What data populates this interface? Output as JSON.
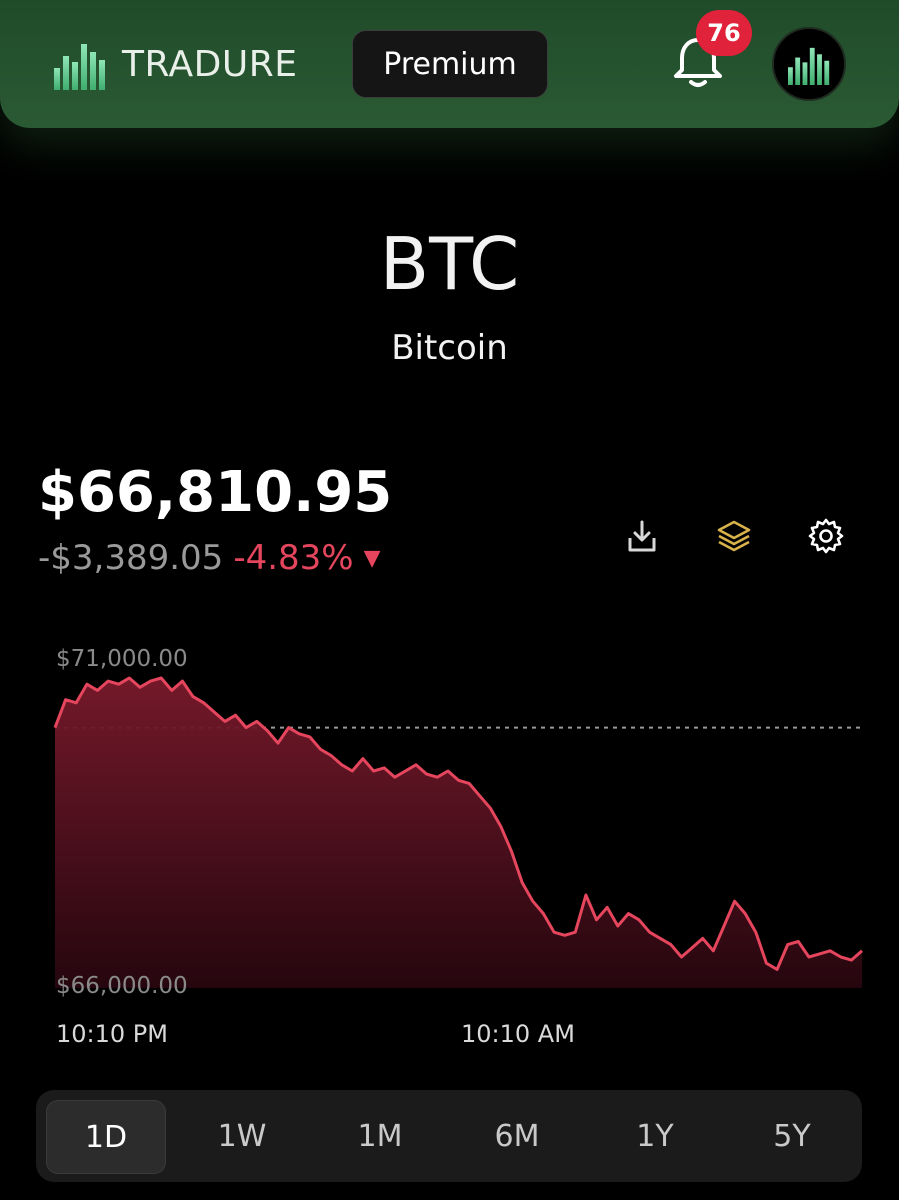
{
  "header": {
    "brand_name": "TRADURE",
    "premium_label": "Premium",
    "notification_count": "76",
    "accent": "#2a5a33"
  },
  "asset": {
    "ticker": "BTC",
    "name": "Bitcoin"
  },
  "price": {
    "current": "$66,810.95",
    "change_abs": "-$3,389.05",
    "change_pct": "-4.83%",
    "direction_icon": "caret-down-icon",
    "negative_color": "#e5465d"
  },
  "tools": [
    {
      "icon": "download-icon"
    },
    {
      "icon": "layers-icon"
    },
    {
      "icon": "gear-icon"
    }
  ],
  "chart_data": {
    "type": "area",
    "y_max_label": "$71,000.00",
    "y_min_label": "$66,000.00",
    "ylim": [
      66000,
      71000
    ],
    "reference_line": 70200,
    "x_labels": [
      "10:10 PM",
      "10:10 AM"
    ],
    "color": "#e5465d",
    "values": [
      70200,
      70650,
      70600,
      70900,
      70800,
      70950,
      70900,
      71000,
      70850,
      70950,
      71000,
      70800,
      70950,
      70700,
      70600,
      70450,
      70300,
      70400,
      70200,
      70300,
      70150,
      69950,
      70200,
      70100,
      70050,
      69850,
      69750,
      69600,
      69500,
      69700,
      69500,
      69550,
      69400,
      69500,
      69600,
      69450,
      69400,
      69500,
      69350,
      69300,
      69100,
      68900,
      68600,
      68200,
      67700,
      67400,
      67200,
      66900,
      66850,
      66900,
      67500,
      67100,
      67300,
      67000,
      67200,
      67100,
      66900,
      66800,
      66700,
      66500,
      66650,
      66800,
      66600,
      67000,
      67400,
      67200,
      66900,
      66400,
      66300,
      66700,
      66750,
      66500,
      66550,
      66600,
      66500,
      66450,
      66600
    ]
  },
  "ranges": {
    "items": [
      "1D",
      "1W",
      "1M",
      "6M",
      "1Y",
      "5Y"
    ],
    "active": "1D"
  }
}
